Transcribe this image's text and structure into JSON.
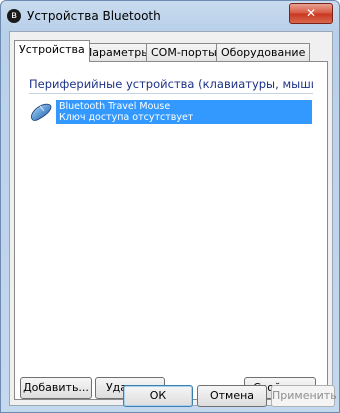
{
  "window": {
    "title": "Устройства Bluetooth",
    "close_glyph": "✕",
    "bluetooth_glyph": "ʙ"
  },
  "tabs": [
    {
      "label": "Устройства",
      "active": true
    },
    {
      "label": "Параметры",
      "active": false
    },
    {
      "label": "COM-порты",
      "active": false
    },
    {
      "label": "Оборудование",
      "active": false
    }
  ],
  "device_list": {
    "group_header": "Периферийные устройства (клавиатуры, мыши, д...",
    "devices": [
      {
        "name": "Bluetooth Travel Mouse",
        "status": "Ключ доступа отсутствует",
        "icon": "mouse-icon",
        "selected": true
      }
    ]
  },
  "actions": {
    "add": "Добавить...",
    "remove": "Удалить",
    "properties": "Свойства"
  },
  "footer": {
    "ok": "ОК",
    "cancel": "Отмена",
    "apply": "Применить"
  },
  "colors": {
    "selection": "#3399ff",
    "group_header": "#1e3287"
  }
}
